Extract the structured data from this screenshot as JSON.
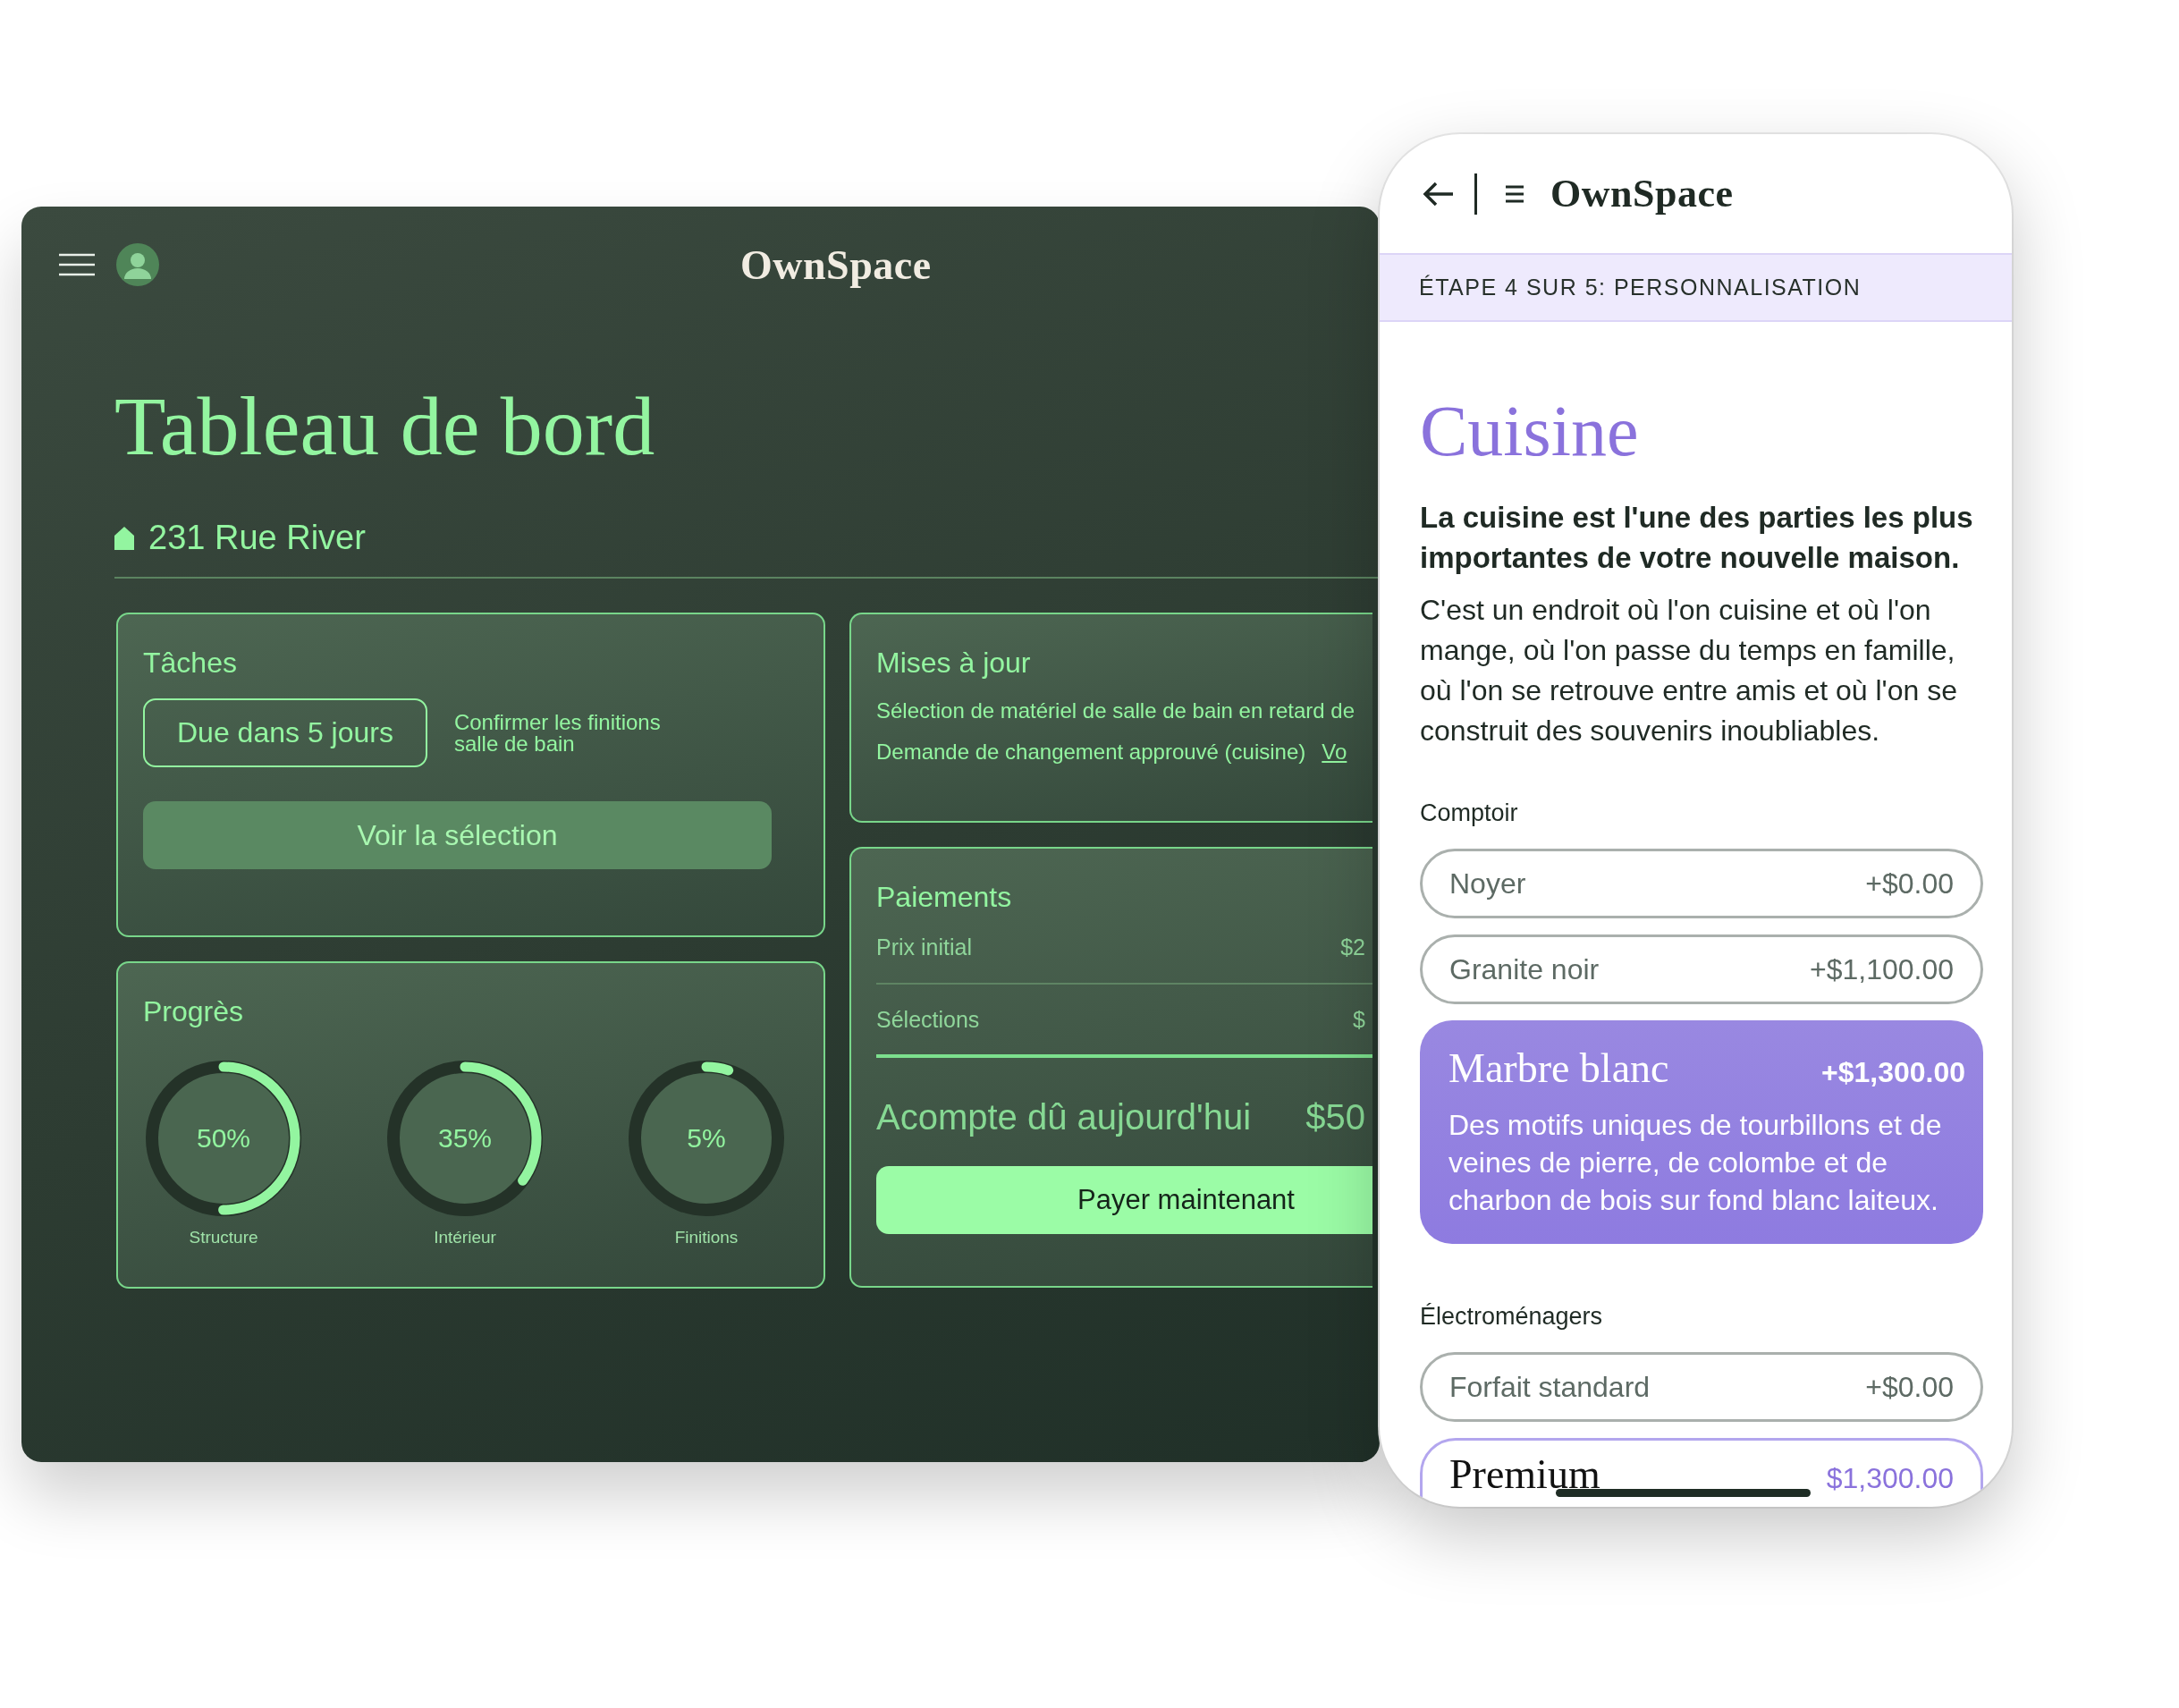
{
  "dashboard": {
    "logo": "OwnSpace",
    "title": "Tableau de bord",
    "address": "231 Rue River",
    "tasks": {
      "title": "Tâches",
      "due": "Due dans 5 jours",
      "task": "Confirmer les finitions salle de bain",
      "button": "Voir la sélection"
    },
    "progress": {
      "title": "Progrès",
      "rings": [
        {
          "reading": "50%",
          "label": "Structure",
          "level": 0.5
        },
        {
          "reading": "35%",
          "label": "Intérieur",
          "level": 0.35
        },
        {
          "reading": "5%",
          "label": "Finitions",
          "level": 0.05
        }
      ]
    },
    "updates": {
      "title": "Mises à jour",
      "items": [
        {
          "text": "Sélection de matériel de salle de bain en retard de"
        },
        {
          "text": "Demande de changement approuvé (cuisine)",
          "link": "Vo"
        }
      ]
    },
    "payments": {
      "title": "Paiements",
      "rows": [
        {
          "label": "Prix initial",
          "amount": "$2"
        },
        {
          "label": "Sélections",
          "amount": "$"
        }
      ],
      "due_label": "Acompte dû aujourd'hui",
      "due_amount": "$50",
      "button": "Payer maintenant"
    }
  },
  "phone": {
    "logo": "OwnSpace",
    "step": "ÉTAPE 4 SUR 5: PERSONNALISATION",
    "title": "Cuisine",
    "lead": "La cuisine est l'une des parties les plus importantes de votre nouvelle maison.",
    "body": "C'est un endroit où l'on cuisine et où l'on mange, où l'on passe du temps en famille, où l'on se retrouve entre amis et où l'on se construit des souvenirs inoubliables.",
    "groups": [
      {
        "label": "Comptoir",
        "options": [
          {
            "name": "Noyer",
            "price": "+$0.00",
            "selected": false,
            "highlighted": false
          },
          {
            "name": "Granite noir",
            "price": "+$1,100.00",
            "selected": false,
            "highlighted": false
          },
          {
            "name": "Marbre blanc",
            "price": "+$1,300.00",
            "selected": true,
            "highlighted": false,
            "description": "Des motifs uniques de tourbillons et de veines de pierre, de colombe et de charbon de bois sur fond blanc laiteux."
          }
        ]
      },
      {
        "label": "Électroménagers",
        "options": [
          {
            "name": "Forfait standard",
            "price": "+$0.00",
            "selected": false,
            "highlighted": false
          },
          {
            "name": "Premium",
            "price": "$1,300.00",
            "selected": false,
            "highlighted": true
          }
        ]
      }
    ]
  }
}
